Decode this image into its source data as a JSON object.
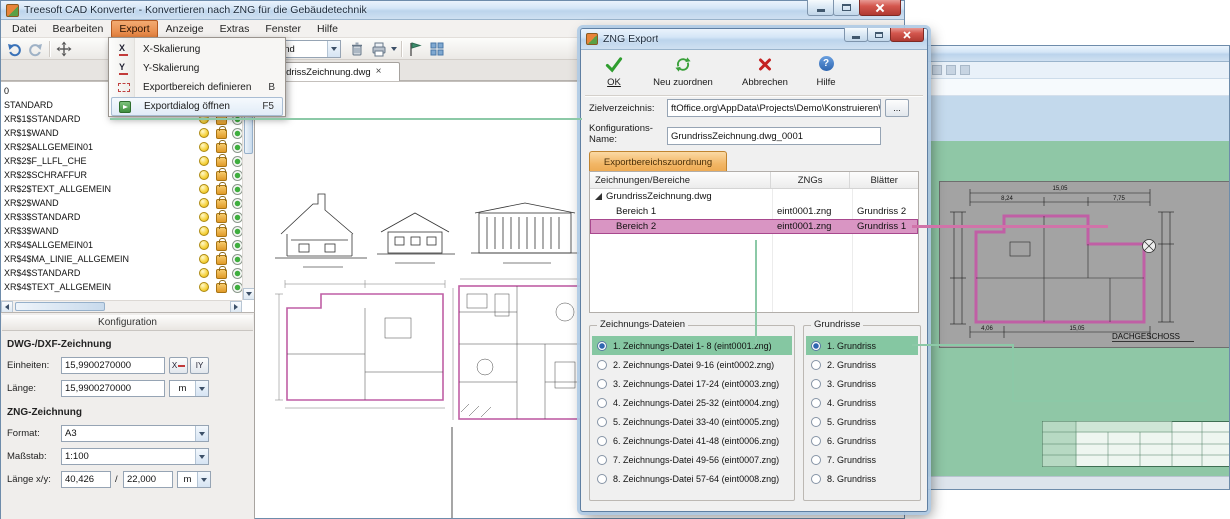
{
  "colors": {
    "selection_green": "#85c7a2",
    "selection_pink": "#d995c3",
    "annotation_green": "#8cc9a7",
    "annotation_pink": "#d173a9",
    "tab_orange": "#f2b665",
    "close_button_red": "#b03a32"
  },
  "main_window": {
    "title": "Treesoft CAD Konverter - Konvertieren nach ZNG für die Gebäudetechnik",
    "menu_items": [
      "Datei",
      "Bearbeiten",
      "Export",
      "Anzeige",
      "Extras",
      "Fenster",
      "Hilfe"
    ],
    "export_menu": {
      "icon_x": "X",
      "icon_y": "Y",
      "item1": "X-Skalierung",
      "item2": "Y-Skalierung",
      "item3": "Exportbereich definieren",
      "item3_shortcut": "B",
      "item4": "Exportdialog öffnen",
      "item4_shortcut": "F5"
    },
    "toolbar": {
      "layer_combo_value": "nd"
    },
    "tab_label": "GrundrissZeichnung.dwg",
    "tab_close": "×",
    "layers": [
      "0",
      "STANDARD",
      "XR$1$STANDARD",
      "XR$1$WAND",
      "XR$2$ALLGEMEIN01",
      "XR$2$F_LLFL_CHE",
      "XR$2$SCHRAFFUR",
      "XR$2$TEXT_ALLGEMEIN",
      "XR$2$WAND",
      "XR$3$STANDARD",
      "XR$3$WAND",
      "XR$4$ALLGEMEIN01",
      "XR$4$MA_LINIE_ALLGEMEIN",
      "XR$4$STANDARD",
      "XR$4$TEXT_ALLGEMEIN"
    ],
    "config": {
      "header": "Konfiguration",
      "section_dwg": "DWG-/DXF-Zeichnung",
      "einheiten_label": "Einheiten:",
      "einheiten_value": "15,9900270000",
      "x_button_label": "X",
      "y_button_label": "IY",
      "laenge_label": "Länge:",
      "laenge_value": "15,9900270000",
      "laenge_unit": "m",
      "section_zng": "ZNG-Zeichnung",
      "format_label": "Format:",
      "format_value": "A3",
      "massstab_label": "Maßstab:",
      "massstab_value": "1:100",
      "laengexy_label": "Länge x/y:",
      "laengex_value": "40,426",
      "divider": "/",
      "laengey_value": "22,000",
      "xy_unit": "m"
    }
  },
  "export_dialog": {
    "title": "ZNG Export",
    "toolbar": {
      "ok": "OK",
      "reassign": "Neu zuordnen",
      "cancel": "Abbrechen",
      "help": "Hilfe",
      "help_glyph": "?"
    },
    "target_label": "Zielverzeichnis:",
    "target_value": "ftOffice.org\\AppData\\Projects\\Demo\\Konstruieren\\TreeCAD",
    "browse_label": "...",
    "config_label": "Konfigurations-Name:",
    "config_value": "GrundrissZeichnung.dwg_0001",
    "tab_label": "Exportbereichszuordnung",
    "mapping_table": {
      "col1": "Zeichnungen/Bereiche",
      "col2": "ZNGs",
      "col3": "Blätter",
      "root": "GrundrissZeichnung.dwg",
      "rows": [
        {
          "name": "Bereich 1",
          "zng": "eint0001.zng",
          "sheet": "Grundriss 2"
        },
        {
          "name": "Bereich 2",
          "zng": "eint0001.zng",
          "sheet": "Grundriss 1"
        }
      ],
      "selected_row_index": 1
    },
    "files_group": {
      "title": "Zeichnungs-Dateien",
      "selected_index": 0,
      "items": [
        "1. Zeichnungs-Datei  1- 8 (eint0001.zng)",
        "2. Zeichnungs-Datei  9-16 (eint0002.zng)",
        "3. Zeichnungs-Datei 17-24 (eint0003.zng)",
        "4. Zeichnungs-Datei 25-32 (eint0004.zng)",
        "5. Zeichnungs-Datei 33-40 (eint0005.zng)",
        "6. Zeichnungs-Datei 41-48 (eint0006.zng)",
        "7. Zeichnungs-Datei 49-56 (eint0007.zng)",
        "8. Zeichnungs-Datei 57-64 (eint0008.zng)"
      ]
    },
    "plans_group": {
      "title": "Grundrisse",
      "selected_index": 0,
      "items": [
        "1. Grundriss",
        "2. Grundriss",
        "3. Grundriss",
        "4. Grundriss",
        "5. Grundriss",
        "6. Grundriss",
        "7. Grundriss",
        "8. Grundriss"
      ]
    }
  },
  "drawing_window": {
    "plan_label": "DACHGESCHOSS",
    "dim_total_top": "15,05",
    "dim_top_left": "8,24",
    "dim_top_right": "7,75",
    "dim_bottom_left": "4,06",
    "dim_bottom_right": "15,05"
  }
}
